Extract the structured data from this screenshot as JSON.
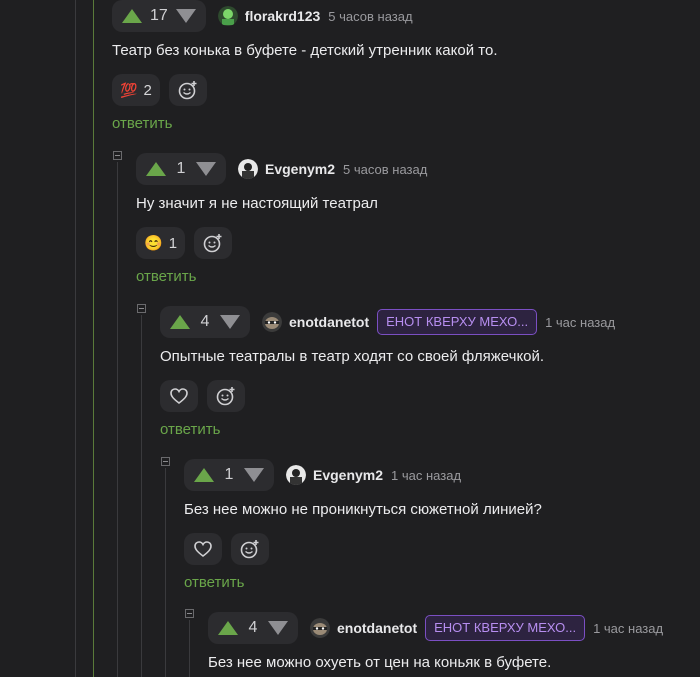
{
  "comments": [
    {
      "score": "17",
      "author": "florakrd123",
      "badge": "",
      "time": "5 часов назад",
      "text": "Театр без конька в буфете - детский утренник какой то.",
      "reactions": [
        {
          "emoji": "💯",
          "count": "2",
          "icon": "hundred-points-icon"
        }
      ],
      "reply": "ответить"
    },
    {
      "score": "1",
      "author": "Evgenym2",
      "badge": "",
      "time": "5 часов назад",
      "text": "Ну значит я не настоящий театрал",
      "reactions": [
        {
          "emoji": "😊",
          "count": "1",
          "icon": "smiling-face-icon"
        }
      ],
      "reply": "ответить"
    },
    {
      "score": "4",
      "author": "enotdanetot",
      "badge": "ЕНОТ КВЕРХУ МЕХО...",
      "time": "1 час назад",
      "text": "Опытные театралы в театр ходят со своей фляжечкой.",
      "reactions": [],
      "reply": "ответить"
    },
    {
      "score": "1",
      "author": "Evgenym2",
      "badge": "",
      "time": "1 час назад",
      "text": "Без нее можно не проникнуться сюжетной линией?",
      "reactions": [],
      "reply": "ответить"
    },
    {
      "score": "4",
      "author": "enotdanetot",
      "badge": "ЕНОТ КВЕРХУ МЕХО...",
      "time": "1 час назад",
      "text": "Без нее можно охуеть от цен на коньяк в буфете.",
      "reactions": [],
      "reply": ""
    }
  ],
  "colors": {
    "accent_green": "#6aa64a",
    "badge_purple": "#7b4fc3",
    "background": "#1f1f21"
  }
}
